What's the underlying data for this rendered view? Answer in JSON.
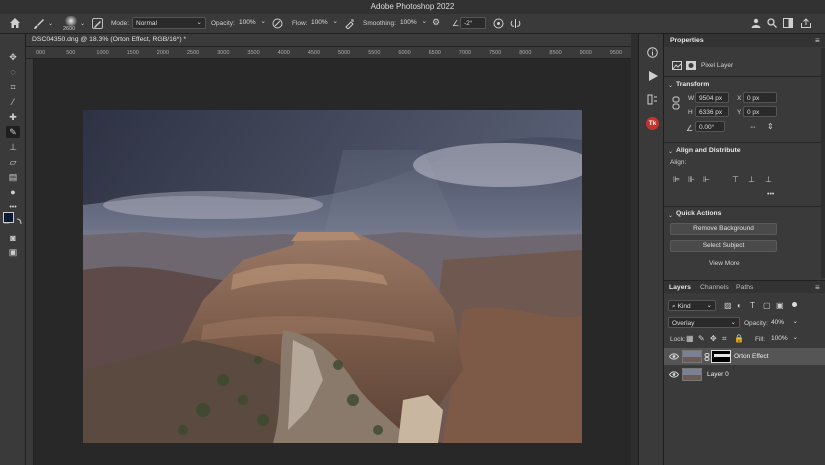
{
  "app": {
    "title": "Adobe Photoshop 2022"
  },
  "options_bar": {
    "brush_size": "2600",
    "mode_label": "Mode:",
    "mode_value": "Normal",
    "opacity_label": "Opacity:",
    "opacity_value": "100%",
    "flow_label": "Flow:",
    "flow_value": "100%",
    "smoothing_label": "Smoothing:",
    "smoothing_value": "100%",
    "angle_value": "-2°"
  },
  "document": {
    "tab_title": "DSC04350.dng @ 18.3% (Orton Effect, RGB/16*) *"
  },
  "ruler": {
    "labels": [
      "000",
      "500",
      "1000",
      "1500",
      "2000",
      "2500",
      "3000",
      "3500",
      "4000",
      "4500",
      "5000",
      "5500",
      "6000",
      "6500",
      "7000",
      "7500",
      "8000",
      "8500",
      "9000",
      "9500"
    ]
  },
  "properties": {
    "title": "Properties",
    "layer_type": "Pixel Layer",
    "transform": {
      "title": "Transform",
      "w_label": "W",
      "w_value": "9504 px",
      "h_label": "H",
      "h_value": "6336 px",
      "x_label": "X",
      "x_value": "0 px",
      "y_label": "Y",
      "y_value": "0 px",
      "angle_value": "0.00°"
    },
    "align": {
      "title": "Align and Distribute",
      "label": "Align:"
    },
    "quick_actions": {
      "title": "Quick Actions",
      "remove_bg": "Remove Background",
      "select_subject": "Select Subject",
      "view_more": "View More"
    }
  },
  "layers_panel": {
    "tabs": [
      "Layers",
      "Channels",
      "Paths"
    ],
    "filter_kind": "Kind",
    "blend_mode": "Overlay",
    "opacity_label": "Opacity:",
    "opacity_value": "40%",
    "lock_label": "Lock:",
    "fill_label": "Fill:",
    "fill_value": "100%",
    "layers": [
      {
        "name": "Orton Effect",
        "selected": true
      },
      {
        "name": "Layer 0",
        "selected": false
      }
    ]
  },
  "colors": {
    "foreground": "#0d1a33",
    "background": "#ffffff",
    "accent": "#c4342d"
  }
}
